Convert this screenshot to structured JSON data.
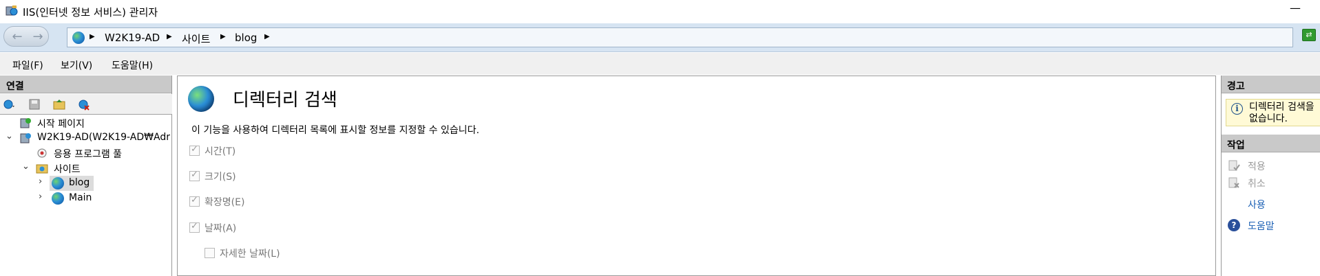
{
  "window": {
    "title": "IIS(인터넷 정보 서비스) 관리자",
    "minimize": "—"
  },
  "address": {
    "crumbs": [
      "W2K19-AD",
      "사이트",
      "blog"
    ],
    "separator": "▶"
  },
  "menu": {
    "items": [
      "파일(F)",
      "보기(V)",
      "도움말(H)"
    ]
  },
  "connections": {
    "header": "연결",
    "tree": {
      "start_page": "시작 페이지",
      "server": "W2K19-AD(W2K19-AD₩Adr",
      "app_pools": "응용 프로그램 풀",
      "sites": "사이트",
      "blog": "blog",
      "main": "Main"
    }
  },
  "feature": {
    "title": "디렉터리 검색",
    "description": "이 기능을 사용하여 디렉터리 목록에 표시할 정보를 지정할 수 있습니다.",
    "options": [
      {
        "label": "시간(T)",
        "checked": true
      },
      {
        "label": "크기(S)",
        "checked": true
      },
      {
        "label": "확장명(E)",
        "checked": true
      },
      {
        "label": "날짜(A)",
        "checked": true
      },
      {
        "label": "자세한 날짜(L)",
        "checked": false
      }
    ]
  },
  "actions": {
    "alerts_header": "경고",
    "alert_line1": "디렉터리 검색을",
    "alert_line2": "없습니다.",
    "actions_header": "작업",
    "apply": "적용",
    "cancel": "취소",
    "enable": "사용",
    "help": "도움말"
  },
  "colors": {
    "accent": "#1a5fb4",
    "header_bg": "#c9c9c9",
    "address_bg": "#d6e4f2",
    "warning_bg": "#fffad6"
  }
}
